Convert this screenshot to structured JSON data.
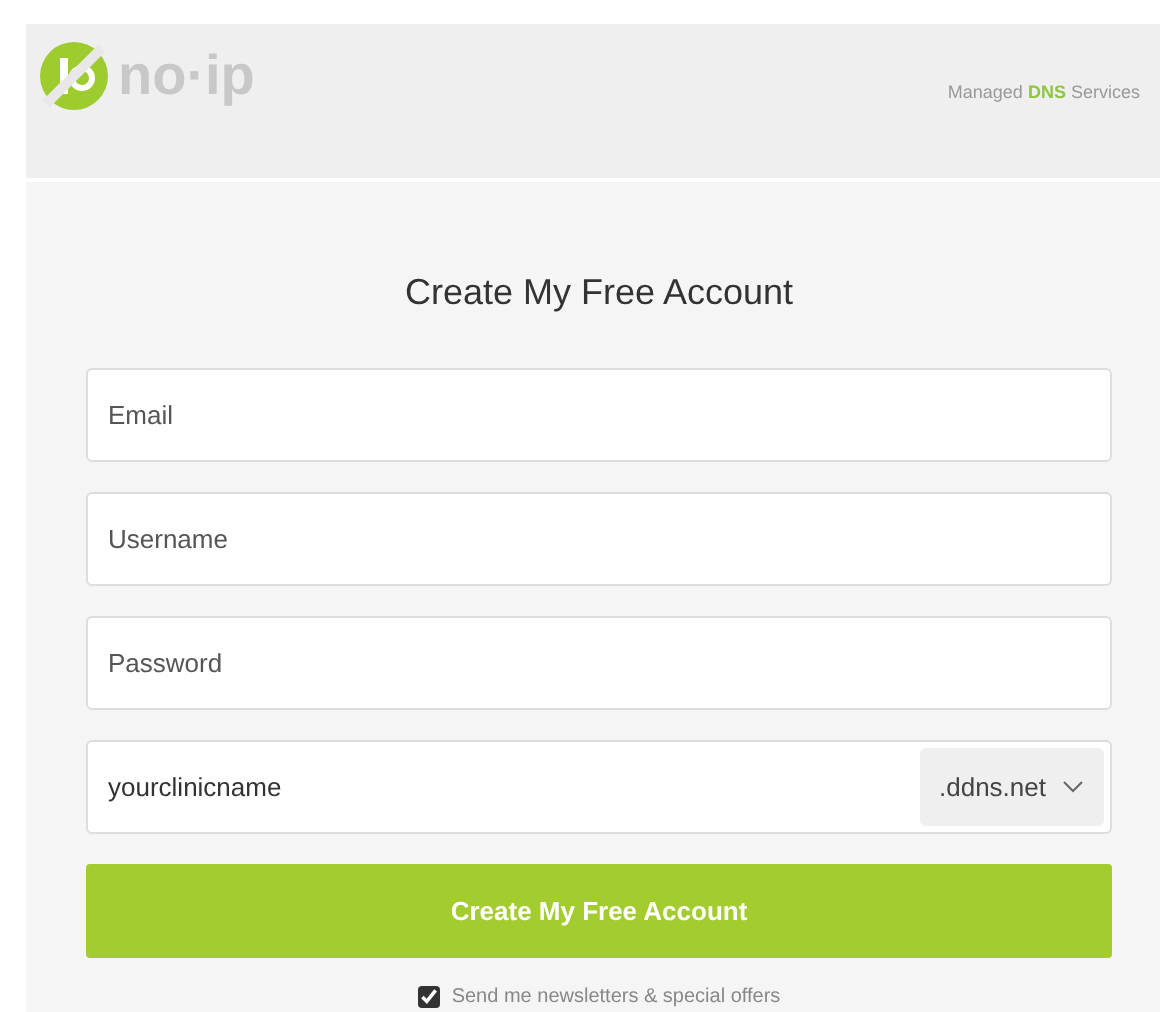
{
  "header": {
    "logo_text": "no·ip",
    "tagline": {
      "before": "Managed",
      "highlight": "DNS",
      "after": "Services"
    }
  },
  "form": {
    "title": "Create My Free Account",
    "fields": [
      {
        "kind": "text",
        "placeholder": "Email"
      },
      {
        "kind": "text",
        "placeholder": "Username"
      },
      {
        "kind": "password",
        "placeholder": "Password"
      },
      {
        "kind": "hostname",
        "value": "yourclinicname",
        "domain": ".ddns.net"
      }
    ],
    "submit": "Create My Free Account",
    "newsletter": {
      "label": "Send me newsletters & special offers",
      "checked": true
    }
  }
}
